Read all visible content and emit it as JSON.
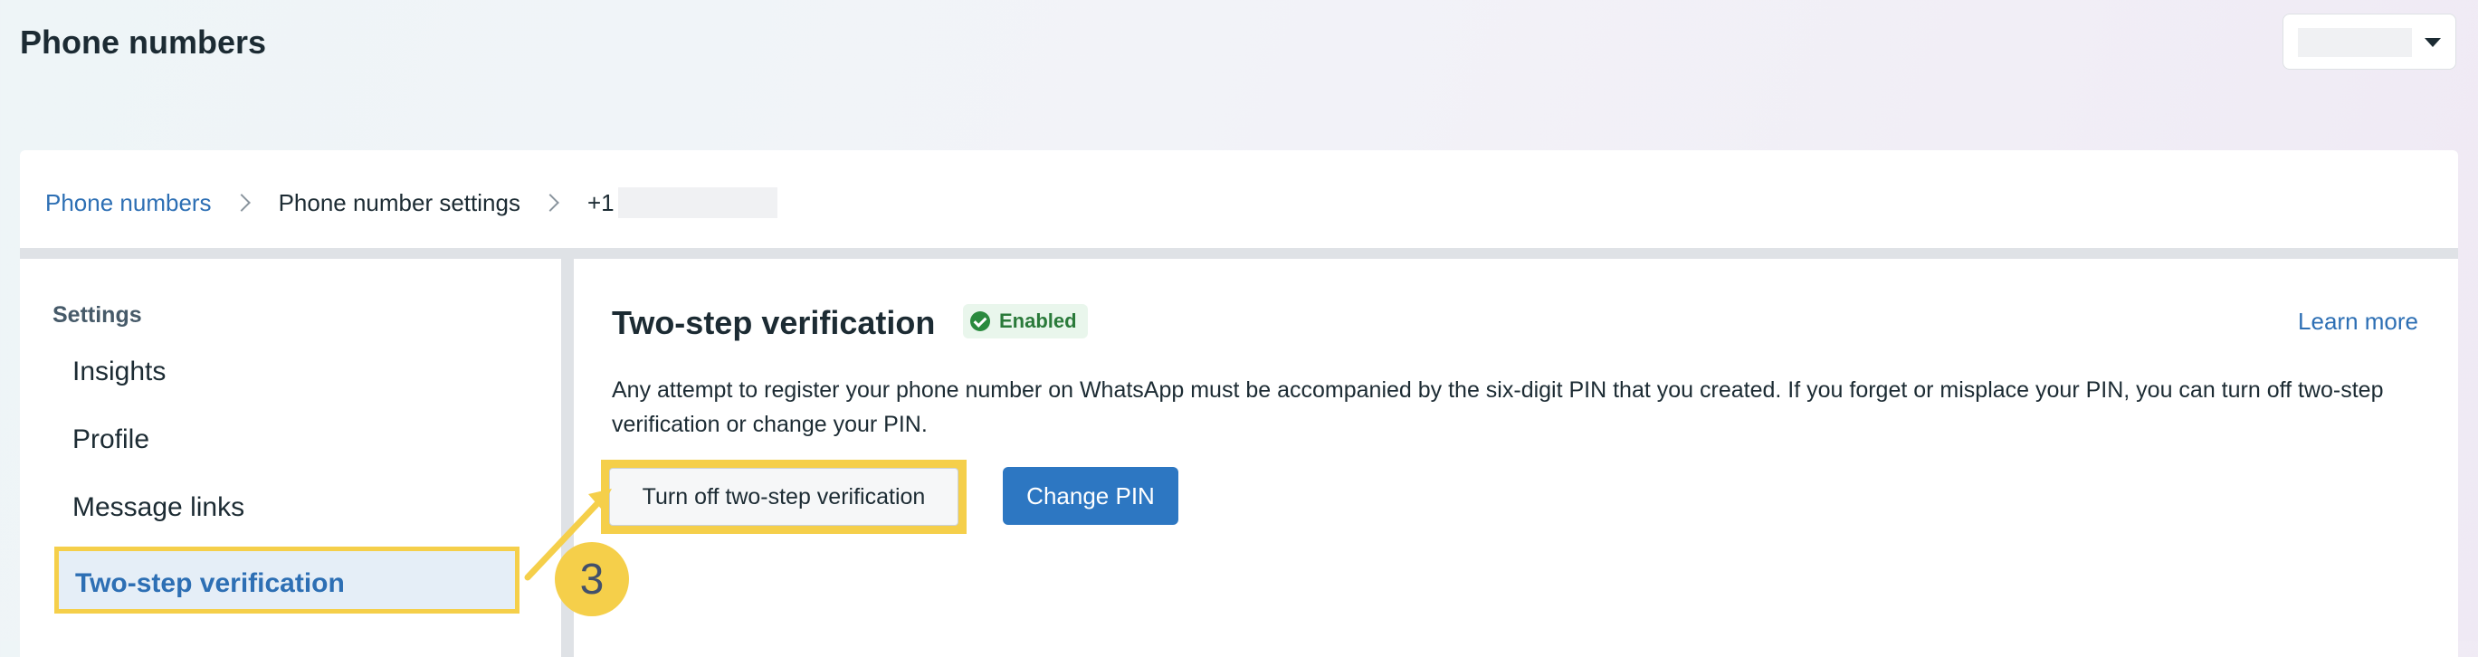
{
  "header": {
    "title": "Phone numbers"
  },
  "account_selector": {
    "value": "",
    "icon": "caret-down-icon"
  },
  "breadcrumb": {
    "items": [
      "Phone numbers",
      "Phone number settings"
    ],
    "phone_prefix": "+1",
    "separator_icon": "chevron-right-icon"
  },
  "sidebar": {
    "heading": "Settings",
    "items": [
      {
        "label": "Insights"
      },
      {
        "label": "Profile"
      },
      {
        "label": "Message links"
      },
      {
        "label": "Two-step verification",
        "active": true
      }
    ]
  },
  "section": {
    "title": "Two-step verification",
    "status": "Enabled",
    "status_icon": "check-circle-icon",
    "learn_more": "Learn more",
    "description": "Any attempt to register your phone number on WhatsApp must be accompanied by the six-digit PIN that you created. If you forget or misplace your PIN, you can turn off two-step verification or change your PIN.",
    "turn_off_label": "Turn off two-step verification",
    "change_pin_label": "Change PIN"
  },
  "annotation": {
    "step": "3",
    "highlight_color": "#f5cf4a"
  },
  "colors": {
    "link": "#2d6fb4",
    "primary_button": "#2d77c2",
    "status_green": "#2a7a3a",
    "active_nav_bg": "#e5eef7"
  }
}
